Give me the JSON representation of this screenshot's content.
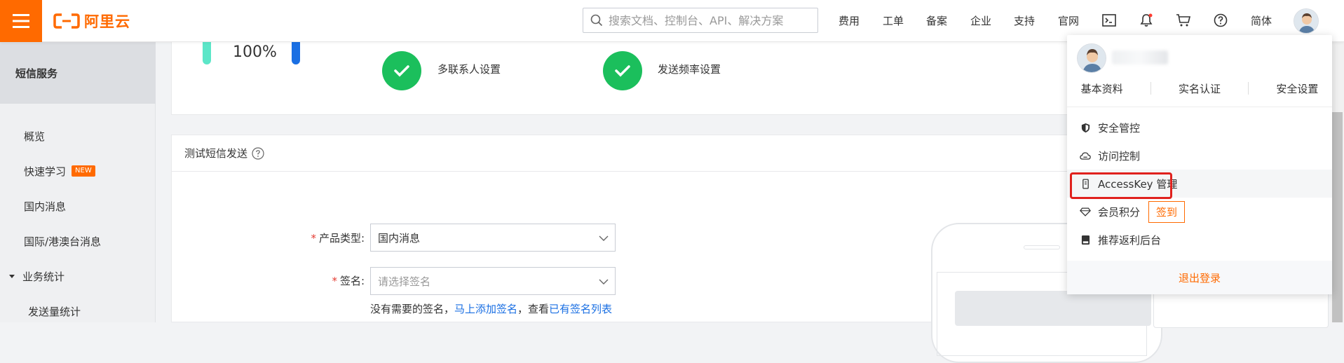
{
  "brand": {
    "logo_text": "阿里云",
    "accent": "#ff6a00"
  },
  "header": {
    "search_placeholder": "搜索文档、控制台、API、解决方案",
    "nav": [
      "费用",
      "工单",
      "备案",
      "企业",
      "支持",
      "官网"
    ],
    "lang": "简体"
  },
  "sidebar": {
    "title": "短信服务",
    "items": [
      {
        "label": "概览"
      },
      {
        "label": "快速学习",
        "badge": "NEW"
      },
      {
        "label": "国内消息"
      },
      {
        "label": "国际/港澳台消息"
      },
      {
        "label": "业务统计"
      },
      {
        "label": "发送量统计"
      }
    ]
  },
  "overview": {
    "percent": "100%",
    "checks": [
      "多联系人设置",
      "发送频率设置"
    ]
  },
  "test_panel": {
    "title": "测试短信发送",
    "product_type_label": "产品类型:",
    "product_type_value": "国内消息",
    "sign_label": "签名:",
    "sign_placeholder": "请选择签名",
    "hint_prefix": "没有需要的签名，",
    "hint_link1": "马上添加签名",
    "hint_mid": "，查看",
    "hint_link2": "已有签名列表",
    "required_mark": "*"
  },
  "user_menu": {
    "links": [
      "基本资料",
      "实名认证",
      "安全设置"
    ],
    "items": [
      {
        "label": "安全管控",
        "icon": "shield-icon"
      },
      {
        "label": "访问控制",
        "icon": "cloud-icon"
      },
      {
        "label": "AccessKey 管理",
        "icon": "key-icon"
      },
      {
        "label": "会员积分",
        "icon": "diamond-icon",
        "button": "签到"
      },
      {
        "label": "推荐返利后台",
        "icon": "book-icon"
      }
    ],
    "logout": "退出登录"
  },
  "colors": {
    "success": "#1bbf5c",
    "link": "#1a6fe3",
    "highlight": "#e0211d"
  }
}
